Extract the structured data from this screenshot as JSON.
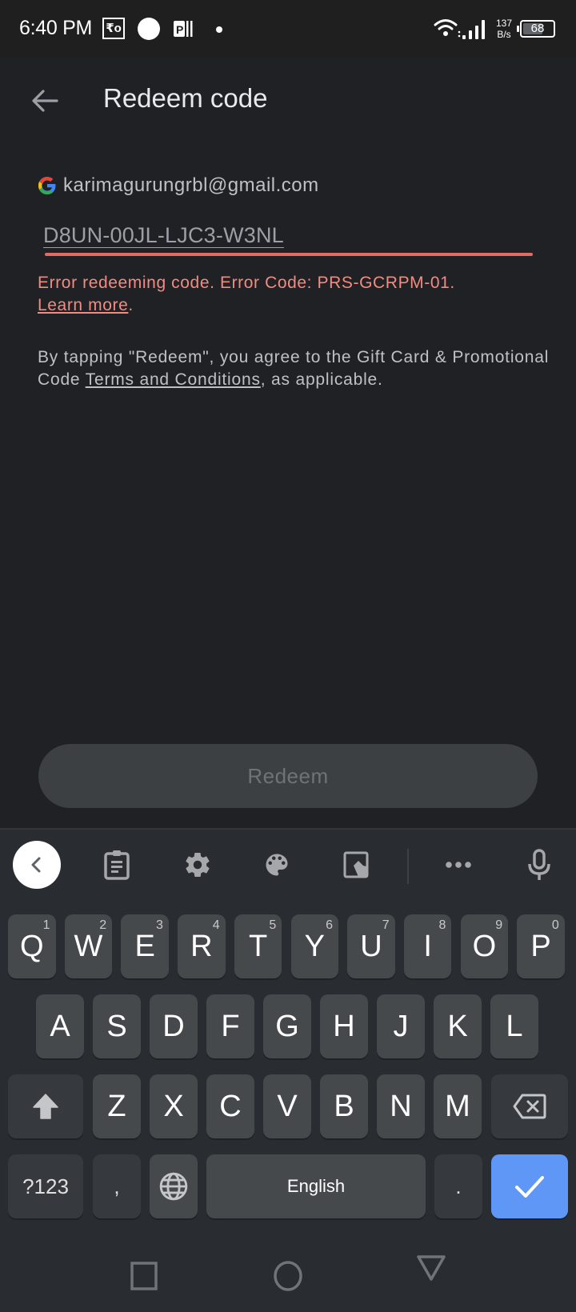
{
  "status_bar": {
    "time": "6:40 PM",
    "notification_icons": [
      "rupee-icon",
      "circle-icon",
      "p-app-icon",
      "dot-icon"
    ],
    "ro_label": "₹o",
    "network_speed_value": "137",
    "network_speed_unit": "B/s",
    "battery_level": "68",
    "battery_percent": 68
  },
  "app_bar": {
    "title": "Redeem code",
    "back_icon": "arrow-left-icon"
  },
  "account": {
    "email": "karimagurungrbl@gmail.com",
    "icon": "google-logo-icon"
  },
  "code_input": {
    "value": "D8UN-00JL-LJC3-W3NL",
    "state": "error"
  },
  "error": {
    "message": "Error redeeming code. Error Code: PRS-GCRPM-01.",
    "link_label": "Learn more",
    "suffix": "."
  },
  "terms": {
    "prefix": "By tapping \"Redeem\", you agree to the Gift Card & Promotional Code ",
    "link_label": "Terms and Conditions",
    "suffix": ", as applicable."
  },
  "redeem_button": {
    "label": "Redeem",
    "enabled": false
  },
  "keyboard": {
    "toolbar": [
      "collapse-icon",
      "clipboard-icon",
      "gear-icon",
      "palette-icon",
      "one-handed-icon",
      "more-icon",
      "microphone-icon"
    ],
    "row1": [
      {
        "key": "Q",
        "hint": "1"
      },
      {
        "key": "W",
        "hint": "2"
      },
      {
        "key": "E",
        "hint": "3"
      },
      {
        "key": "R",
        "hint": "4"
      },
      {
        "key": "T",
        "hint": "5"
      },
      {
        "key": "Y",
        "hint": "6"
      },
      {
        "key": "U",
        "hint": "7"
      },
      {
        "key": "I",
        "hint": "8"
      },
      {
        "key": "O",
        "hint": "9"
      },
      {
        "key": "P",
        "hint": "0"
      }
    ],
    "row2": [
      "A",
      "S",
      "D",
      "F",
      "G",
      "H",
      "J",
      "K",
      "L"
    ],
    "row3": [
      "Z",
      "X",
      "C",
      "V",
      "B",
      "N",
      "M"
    ],
    "symbols_label": "?123",
    "comma": ",",
    "space_label": "English",
    "period": ".",
    "accent_color": "#5e97f6"
  },
  "nav_bar": [
    "recents-icon",
    "home-icon",
    "back-icon"
  ],
  "colors": {
    "background": "#202124",
    "error": "#f28b82",
    "keyboard_bg": "#292d32",
    "key_bg": "#46494c"
  }
}
